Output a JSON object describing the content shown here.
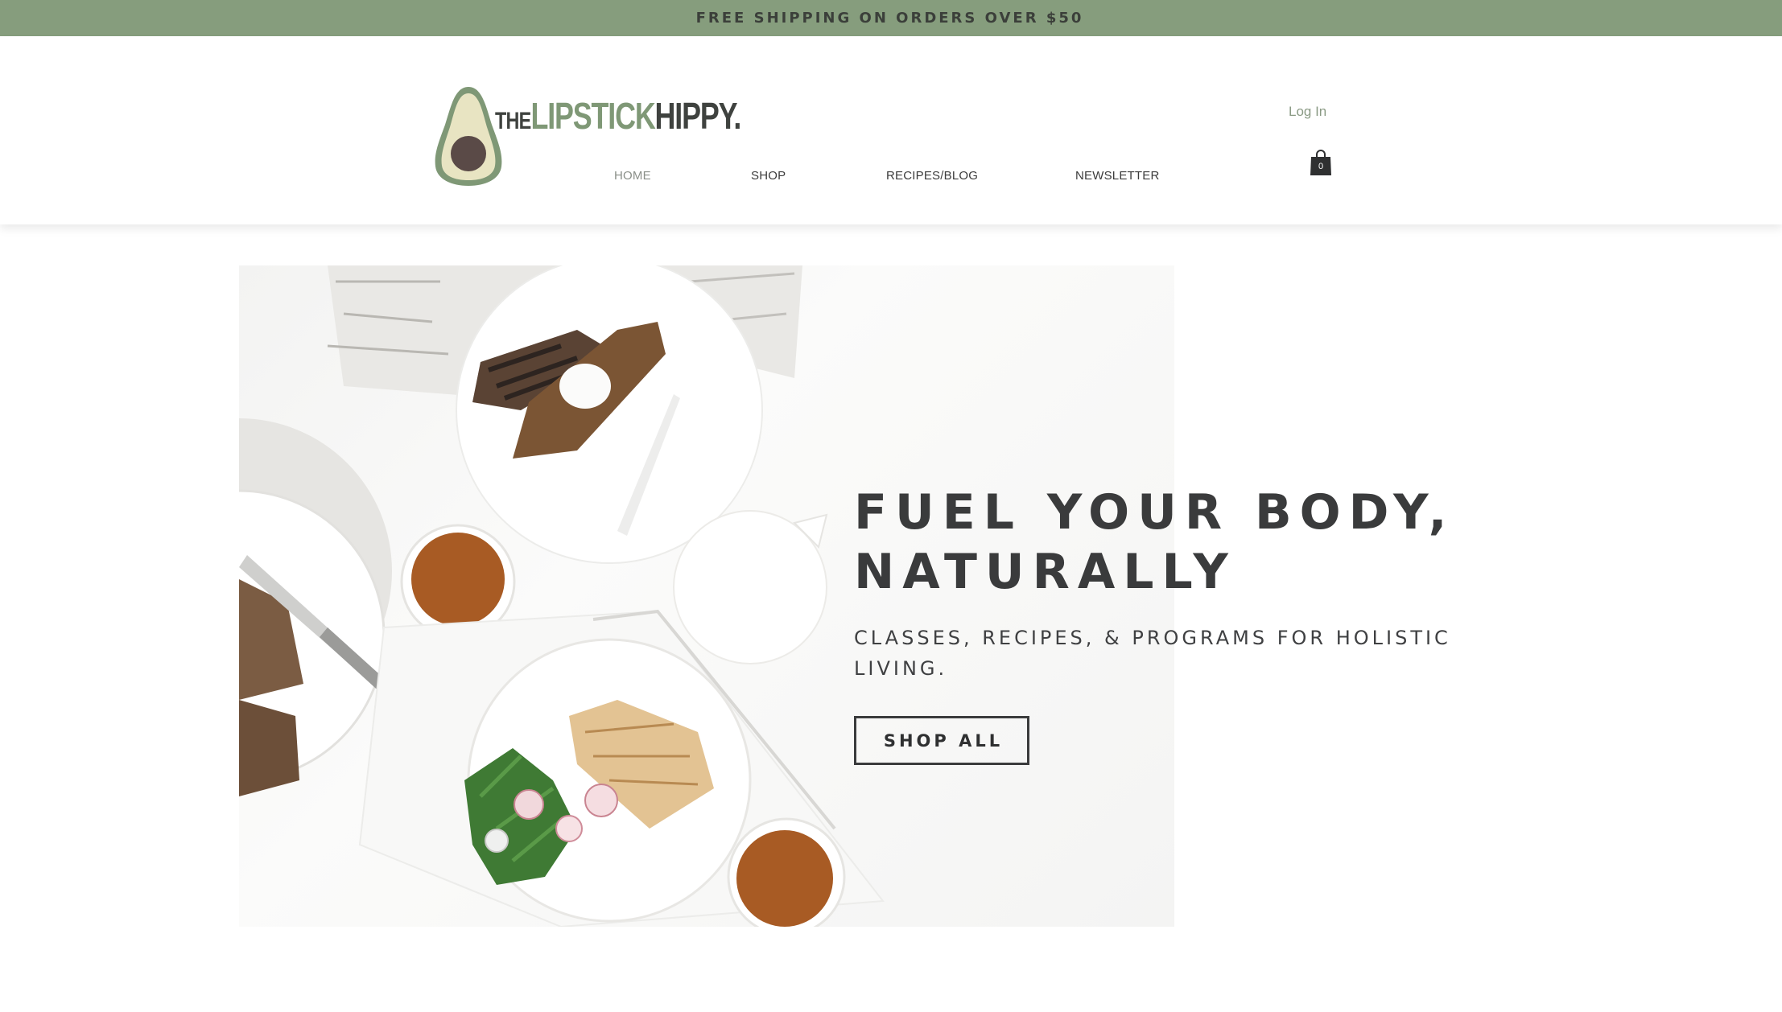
{
  "announcement": {
    "text": "FREE SHIPPING ON ORDERS OVER $50",
    "background": "#869d7d"
  },
  "logo": {
    "the": "THE",
    "lipstick": "LIPSTICK",
    "hippy": "HIPPY.",
    "brand_green": "#7f9876",
    "brand_dark": "#3f423f"
  },
  "nav": {
    "items": [
      {
        "label": "HOME",
        "active": true
      },
      {
        "label": "SHOP",
        "active": false
      },
      {
        "label": "RECIPES/BLOG",
        "active": false
      },
      {
        "label": "NEWSLETTER",
        "active": false
      }
    ]
  },
  "account": {
    "login_label": "Log In"
  },
  "cart": {
    "count": "0",
    "icon": "shopping-bag-icon"
  },
  "hero": {
    "heading_line1": "FUEL YOUR BODY,",
    "heading_line2": "NATURALLY",
    "subheading": "CLASSES, RECIPES, & PROGRAMS FOR HOLISTIC LIVING.",
    "cta_label": "SHOP ALL"
  }
}
